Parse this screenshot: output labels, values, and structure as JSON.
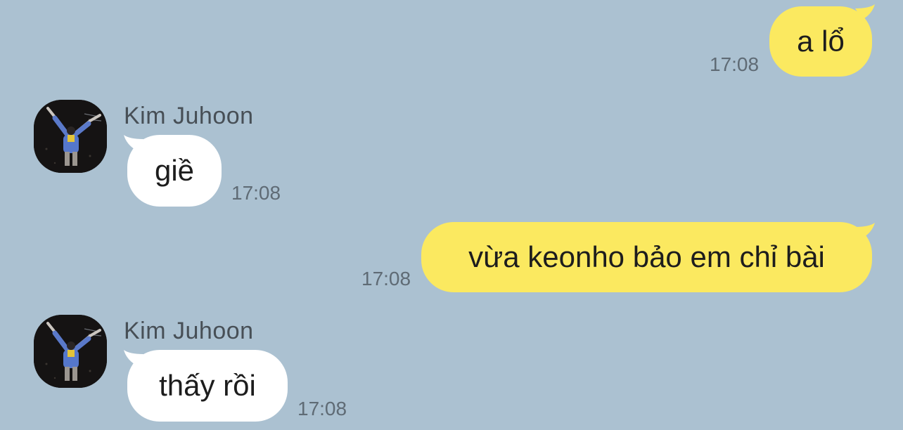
{
  "messages": [
    {
      "direction": "outgoing",
      "text": "a lổ",
      "time": "17:08"
    },
    {
      "direction": "incoming",
      "sender": "Kim Juhoon",
      "text": "giề",
      "time": "17:08",
      "avatar_icon": "contact-photo"
    },
    {
      "direction": "outgoing",
      "text": "vừa keonho bảo em chỉ bài",
      "time": "17:08"
    },
    {
      "direction": "incoming",
      "sender": "Kim Juhoon",
      "text": "thấy rồi",
      "time": "17:08",
      "avatar_icon": "contact-photo"
    }
  ],
  "colors": {
    "background": "#abc1d1",
    "outgoing_bubble": "#fbe960",
    "incoming_bubble": "#ffffff",
    "timestamp": "#5f6b75",
    "sender_name": "#474f56"
  }
}
